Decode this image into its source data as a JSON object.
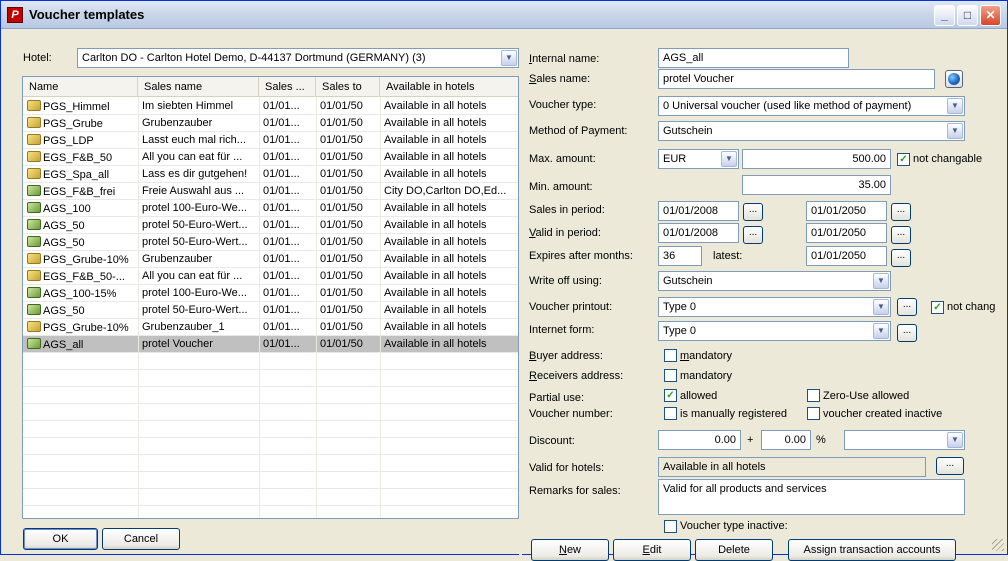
{
  "window": {
    "title": "Voucher templates"
  },
  "hotel": {
    "label": "Hotel:",
    "value": "Carlton DO - Carlton Hotel Demo, D-44137 Dortmund (GERMANY)  (3)"
  },
  "list": {
    "columns": [
      "Name",
      "Sales name",
      "Sales ...",
      "Sales to",
      "Available in hotels"
    ],
    "rows": [
      {
        "icon": "yellow",
        "name": "PGS_Himmel",
        "sales_name": "Im siebten Himmel",
        "from": "01/01...",
        "to": "01/01/50",
        "hotels": "Available in all hotels"
      },
      {
        "icon": "yellow",
        "name": "PGS_Grube",
        "sales_name": "Grubenzauber",
        "from": "01/01...",
        "to": "01/01/50",
        "hotels": "Available in all hotels"
      },
      {
        "icon": "yellow",
        "name": "PGS_LDP",
        "sales_name": "Lasst euch mal rich...",
        "from": "01/01...",
        "to": "01/01/50",
        "hotels": "Available in all hotels"
      },
      {
        "icon": "yellow",
        "name": "EGS_F&B_50",
        "sales_name": "All you can eat für ...",
        "from": "01/01...",
        "to": "01/01/50",
        "hotels": "Available in all hotels"
      },
      {
        "icon": "yellow",
        "name": "EGS_Spa_all",
        "sales_name": "Lass es dir gutgehen!",
        "from": "01/01...",
        "to": "01/01/50",
        "hotels": "Available in all hotels"
      },
      {
        "icon": "green",
        "name": "EGS_F&B_frei",
        "sales_name": "Freie Auswahl aus ...",
        "from": "01/01...",
        "to": "01/01/50",
        "hotels": "City DO,Carlton DO,Ed..."
      },
      {
        "icon": "green",
        "name": "AGS_100",
        "sales_name": "protel 100-Euro-We...",
        "from": "01/01...",
        "to": "01/01/50",
        "hotels": "Available in all hotels"
      },
      {
        "icon": "green",
        "name": "AGS_50",
        "sales_name": "protel 50-Euro-Wert...",
        "from": "01/01...",
        "to": "01/01/50",
        "hotels": "Available in all hotels"
      },
      {
        "icon": "green",
        "name": "AGS_50",
        "sales_name": "protel 50-Euro-Wert...",
        "from": "01/01...",
        "to": "01/01/50",
        "hotels": "Available in all hotels"
      },
      {
        "icon": "yellow",
        "name": "PGS_Grube-10%",
        "sales_name": "Grubenzauber",
        "from": "01/01...",
        "to": "01/01/50",
        "hotels": "Available in all hotels"
      },
      {
        "icon": "yellow",
        "name": "EGS_F&B_50-...",
        "sales_name": "All you can eat für ...",
        "from": "01/01...",
        "to": "01/01/50",
        "hotels": "Available in all hotels"
      },
      {
        "icon": "green",
        "name": "AGS_100-15%",
        "sales_name": "protel 100-Euro-We...",
        "from": "01/01...",
        "to": "01/01/50",
        "hotels": "Available in all hotels"
      },
      {
        "icon": "green",
        "name": "AGS_50",
        "sales_name": "protel 50-Euro-Wert...",
        "from": "01/01...",
        "to": "01/01/50",
        "hotels": "Available in all hotels"
      },
      {
        "icon": "yellow",
        "name": "PGS_Grube-10%",
        "sales_name": "Grubenzauber_1",
        "from": "01/01...",
        "to": "01/01/50",
        "hotels": "Available in all hotels"
      },
      {
        "icon": "green",
        "name": "AGS_all",
        "sales_name": "protel Voucher",
        "from": "01/01...",
        "to": "01/01/50",
        "hotels": "Available in all hotels",
        "selected": true
      }
    ]
  },
  "buttons": {
    "ok": "OK",
    "cancel": "Cancel",
    "new": "New",
    "edit": "Edit",
    "delete": "Delete",
    "assign": "Assign transaction accounts"
  },
  "form": {
    "internal_name": {
      "label": "Internal name:",
      "value": "AGS_all"
    },
    "sales_name": {
      "label": "Sales name:",
      "value": "protel Voucher"
    },
    "voucher_type": {
      "label": "Voucher type:",
      "value": "0 Universal voucher (used like method of payment)"
    },
    "method_payment": {
      "label": "Method of Payment:",
      "value": "Gutschein"
    },
    "max_amount": {
      "label": "Max. amount:",
      "currency": "EUR",
      "value": "500.00",
      "check_label": "not changable"
    },
    "min_amount": {
      "label": "Min. amount:",
      "value": "35.00"
    },
    "sales_period": {
      "label": "Sales in period:",
      "from": "01/01/2008",
      "to": "01/01/2050"
    },
    "valid_period": {
      "label": "Valid in period:",
      "from": "01/01/2008",
      "to": "01/01/2050"
    },
    "expires": {
      "label": "Expires after months:",
      "value": "36",
      "latest_label": "latest:",
      "latest": "01/01/2050"
    },
    "write_off": {
      "label": "Write off using:",
      "value": "Gutschein"
    },
    "printout": {
      "label": "Voucher printout:",
      "value": "Type 0",
      "check_label": "not chang"
    },
    "internet_form": {
      "label": "Internet form:",
      "value": "Type 0"
    },
    "buyer_address": {
      "label": "Buyer address:",
      "check_label": "mandatory"
    },
    "receivers_address": {
      "label": "Receivers address:",
      "check_label": "mandatory"
    },
    "partial_use": {
      "label": "Partial use:",
      "check_label": "allowed",
      "zero_label": "Zero-Use allowed"
    },
    "voucher_number": {
      "label": "Voucher number:",
      "check_label": "is manually registered",
      "inactive_label": "voucher created inactive"
    },
    "discount": {
      "label": "Discount:",
      "value1": "0.00",
      "plus": "+",
      "value2": "0.00",
      "pct": "%",
      "select": ""
    },
    "valid_hotels": {
      "label": "Valid for hotels:",
      "value": "Available in all hotels"
    },
    "remarks": {
      "label": "Remarks for sales:",
      "value": "Valid for all products and services"
    },
    "type_inactive": {
      "check_label": "Voucher type inactive:"
    }
  },
  "ellipsis": "...",
  "icons": {
    "check": "✓",
    "dropdown": "▼"
  }
}
